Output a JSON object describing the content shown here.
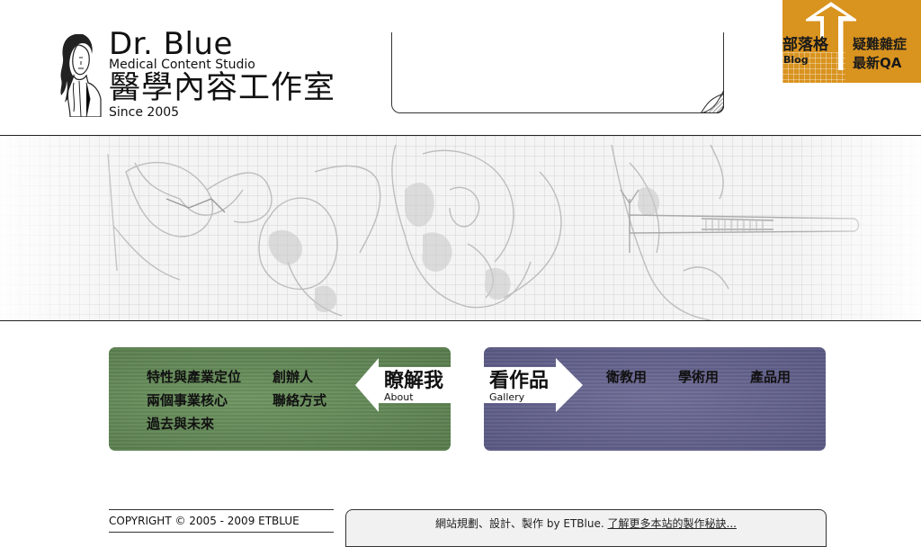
{
  "brand": {
    "title": "Dr. Blue",
    "subtitle": "Medical Content Studio",
    "name_cn": "醫學內容工作室",
    "since": "Since 2005"
  },
  "blog_badge": {
    "label_cn": "部落格",
    "label_en": "Blog",
    "qa_line1": "疑難雜症",
    "qa_line2": "最新QA",
    "color": "#d9931f"
  },
  "about_panel": {
    "color": "#6b8e5e",
    "links": [
      "特性與產業定位",
      "創辦人",
      "兩個事業核心",
      "聯絡方式",
      "過去與未來"
    ],
    "tag_cn": "瞭解我",
    "tag_en": "About"
  },
  "gallery_panel": {
    "color": "#68678f",
    "links": [
      "衛教用",
      "學術用",
      "產品用"
    ],
    "tag_cn": "看作品",
    "tag_en": "Gallery"
  },
  "footer": {
    "copyright": "COPYRIGHT © 2005 - 2009 ETBLUE",
    "credit_text": "網站規劃、設計、製作 by ETBlue.",
    "credit_link": "了解更多本站的製作秘訣..."
  }
}
